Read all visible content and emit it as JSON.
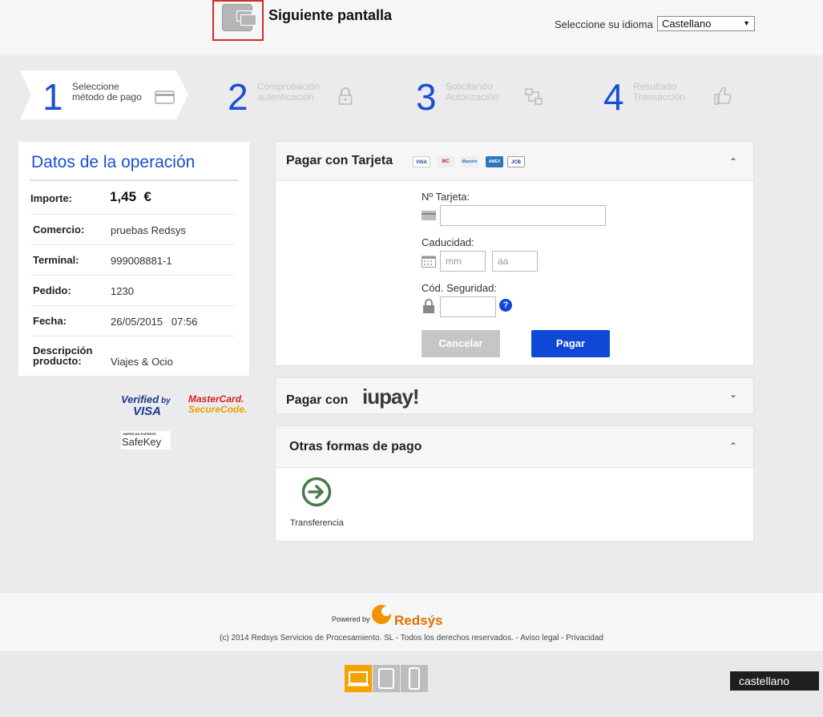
{
  "header": {
    "next_screen_label": "Siguiente pantalla",
    "language_label": "Seleccione su idioma",
    "language_selected": "Castellano"
  },
  "steps": [
    {
      "num": "1",
      "label": "Seleccione\nmétodo de pago",
      "icon": "credit-card-icon",
      "active": true
    },
    {
      "num": "2",
      "label": "Comprobación\nautenticación",
      "icon": "lock-icon",
      "active": false
    },
    {
      "num": "3",
      "label": "Solicitando\nAutorización",
      "icon": "network-icon",
      "active": false
    },
    {
      "num": "4",
      "label": "Resultado\nTransacción",
      "icon": "thumbs-up-icon",
      "active": false
    }
  ],
  "operation": {
    "title": "Datos de la operación",
    "amount_label": "Importe:",
    "amount_value": "1,45  €",
    "rows": [
      {
        "label": "Comercio:",
        "value": "pruebas Redsys"
      },
      {
        "label": "Terminal:",
        "value": "999008881-1"
      },
      {
        "label": "Pedido:",
        "value": "1230"
      },
      {
        "label": "Fecha:",
        "value": "26/05/2015   07:56"
      },
      {
        "label": "Descripción\nproducto:",
        "value": "Viajes & Ocio"
      }
    ]
  },
  "security_logos": {
    "verified_1": "Verified",
    "verified_2": "by",
    "verified_3": "VISA",
    "mc_1": "MasterCard.",
    "mc_2": "SecureCode.",
    "amex_small": "AMERICAN EXPRESS",
    "safekey": "SafeKey"
  },
  "card_payment": {
    "title": "Pagar con Tarjeta",
    "brands": [
      "VISA",
      "MC",
      "Maestro",
      "AMEX",
      "JCB"
    ],
    "card_number_label": "Nº Tarjeta:",
    "expiry_label": "Caducidad:",
    "month_placeholder": "mm",
    "year_placeholder": "aa",
    "cvv_label": "Cód. Seguridad:",
    "help": "?",
    "cancel_label": "Cancelar",
    "pay_label": "Pagar"
  },
  "iupay": {
    "title": "Pagar con",
    "brand": "iupay!"
  },
  "other_methods": {
    "title": "Otras formas de pago",
    "transfer_label": "Transferencia"
  },
  "footer": {
    "powered_by": "Powered by",
    "brand": "Redsýs",
    "copyright": "(c) 2014 Redsys Servicios de Procesamiento. SL - Todos los derechos reservados. -",
    "legal": "Aviso legal",
    "sep": "-",
    "privacy": "Privacidad"
  },
  "bottom_language": "castellano",
  "colors": {
    "accent": "#1a4fd0",
    "pay_button": "#0f47d6",
    "cancel_button": "#c6c6c6",
    "highlight_border": "#d62b2b",
    "device_active": "#f4a300"
  }
}
